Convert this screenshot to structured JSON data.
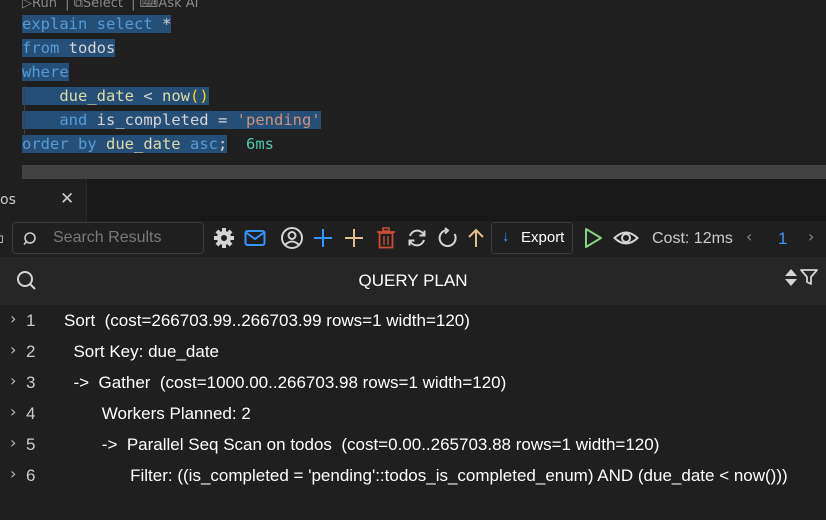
{
  "editor": {
    "codelens": {
      "run": "Run",
      "select": "Select",
      "ask_ai": "Ask AI"
    },
    "lines": {
      "l1_kw": "explain select",
      "l1_star": " *",
      "l2_kw": "from",
      "l2_table": " todos",
      "l3_kw": "where",
      "l4_indent": "    ",
      "l4_col": "due_date",
      "l4_op": " < ",
      "l4_fn": "now",
      "l4_paren": "()",
      "l5_indent": "    ",
      "l5_and": "and",
      "l5_col": " is_completed",
      "l5_op": " = ",
      "l5_str": "'pending'",
      "l6_kw": "order by",
      "l6_col": " due_date",
      "l6_asc": " asc",
      "l6_semi": ";",
      "timing": "6ms"
    }
  },
  "tab": {
    "label": "os",
    "close_glyph": "✕"
  },
  "toolbar": {
    "search_placeholder": "Search Results",
    "export_arrow": "↓",
    "export_label": "Export",
    "cost": "Cost: 12ms",
    "prev": "‹",
    "page": "1",
    "next": "›",
    "colors": {
      "accent": "#3794ff",
      "add": "#e2c08d",
      "run": "#89d185",
      "delete": "#c74e39"
    }
  },
  "results": {
    "column_header": "QUERY PLAN",
    "rows": [
      {
        "num": "1",
        "value": "Sort  (cost=266703.99..266703.99 rows=1 width=120)"
      },
      {
        "num": "2",
        "value": "  Sort Key: due_date"
      },
      {
        "num": "3",
        "value": "  ->  Gather  (cost=1000.00..266703.98 rows=1 width=120)"
      },
      {
        "num": "4",
        "value": "        Workers Planned: 2"
      },
      {
        "num": "5",
        "value": "        ->  Parallel Seq Scan on todos  (cost=0.00..265703.88 rows=1 width=120)"
      },
      {
        "num": "6",
        "value": "              Filter: ((is_completed = 'pending'::todos_is_completed_enum) AND (due_date < now()))"
      }
    ],
    "chevron": "›"
  }
}
